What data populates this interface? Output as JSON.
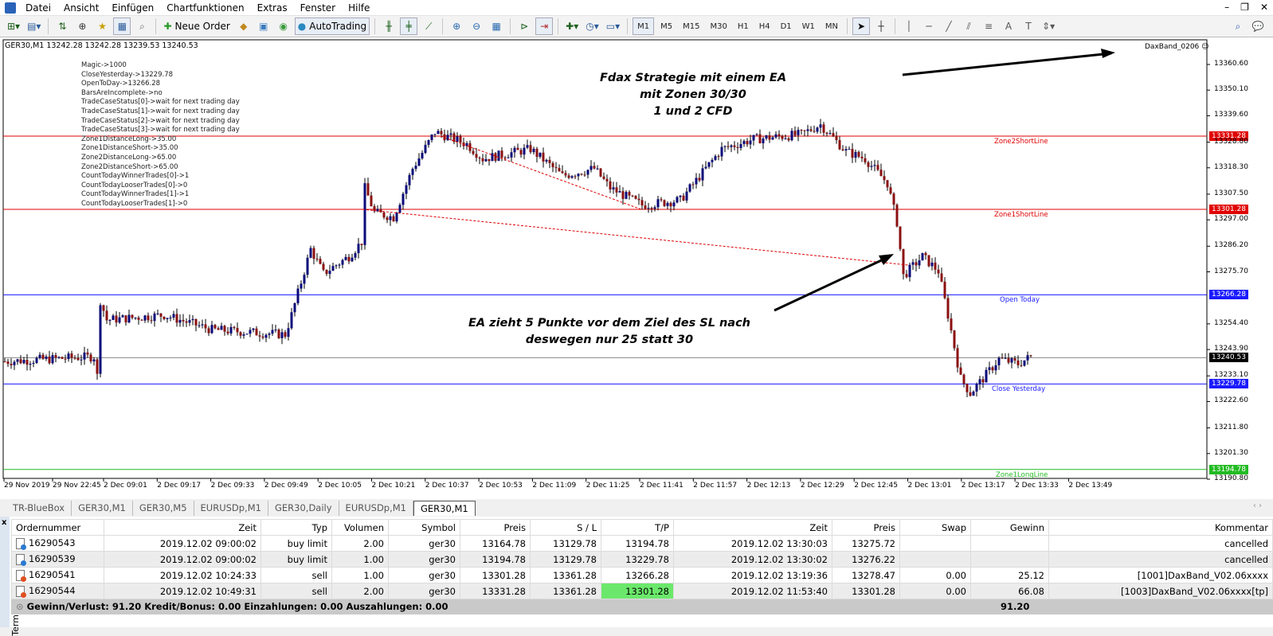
{
  "menu": {
    "items": [
      "Datei",
      "Ansicht",
      "Einfügen",
      "Chartfunktionen",
      "Extras",
      "Fenster",
      "Hilfe"
    ]
  },
  "toolbar": {
    "new_order": "Neue Order",
    "autotrading": "AutoTrading",
    "timeframes": [
      "M1",
      "M5",
      "M15",
      "M30",
      "H1",
      "H4",
      "D1",
      "W1",
      "MN"
    ],
    "active_timeframe": "M1"
  },
  "chart": {
    "symbol_line": "GER30,M1  13242.28 13242.28 13239.53 13240.53",
    "ea_name": "DaxBand_0206",
    "info_lines": [
      "Magic->1000",
      "CloseYesterday->13229.78",
      "OpenToDay->13266.28",
      "BarsAreIncomplete->no",
      "TradeCaseStatus[0]->wait for next trading day",
      "TradeCaseStatus[1]->wait for next trading day",
      "TradeCaseStatus[2]->wait for next trading day",
      "TradeCaseStatus[3]->wait for next trading day",
      "Zone1DistanceLong->35.00",
      "Zone1DistanceShort->35.00",
      "Zone2DistanceLong->65.00",
      "Zone2DistanceShort->65.00",
      "CountTodayWinnerTrades[0]->1",
      "CountTodayLooserTrades[0]->0",
      "CountTodayWinnerTrades[1]->1",
      "CountTodayLooserTrades[1]->0"
    ],
    "annotation1": [
      "Fdax Strategie mit einem EA",
      "mit Zonen 30/30",
      "1 und 2 CFD"
    ],
    "annotation2": [
      "EA zieht 5 Punkte vor dem Ziel des SL nach",
      "deswegen nur 25 statt 30"
    ],
    "price_ticks": [
      "13360.60",
      "13350.10",
      "13339.60",
      "13328.80",
      "13318.30",
      "13307.50",
      "13297.00",
      "13286.20",
      "13275.70",
      "13254.40",
      "13243.90",
      "13233.10",
      "13222.60",
      "13211.80",
      "13201.30",
      "13190.80"
    ],
    "price_range": [
      13190.8,
      13360.6
    ],
    "levels": [
      {
        "price": 13331.28,
        "label": "13331.28",
        "name": "Zone2ShortLine",
        "color": "#e00000"
      },
      {
        "price": 13301.28,
        "label": "13301.28",
        "name": "Zone1ShortLine",
        "color": "#e00000"
      },
      {
        "price": 13266.28,
        "label": "13266.28",
        "name": "Open Today",
        "color": "#1a1aff"
      },
      {
        "price": 13240.53,
        "label": "13240.53",
        "name": "",
        "color": "#000000"
      },
      {
        "price": 13229.78,
        "label": "13229.78",
        "name": "Close Yesterday",
        "color": "#1a1aff"
      },
      {
        "price": 13194.78,
        "label": "13194.78",
        "name": "Zone1LongLine",
        "color": "#22bb22"
      }
    ],
    "time_labels": [
      "29 Nov 2019",
      "29 Nov 22:45",
      "2 Dec 09:01",
      "2 Dec 09:17",
      "2 Dec 09:33",
      "2 Dec 09:49",
      "2 Dec 10:05",
      "2 Dec 10:21",
      "2 Dec 10:37",
      "2 Dec 10:53",
      "2 Dec 11:09",
      "2 Dec 11:25",
      "2 Dec 11:41",
      "2 Dec 11:57",
      "2 Dec 12:13",
      "2 Dec 12:29",
      "2 Dec 12:45",
      "2 Dec 13:01",
      "2 Dec 13:17",
      "2 Dec 13:33",
      "2 Dec 13:49"
    ],
    "price_path": [
      [
        0,
        13239
      ],
      [
        28,
        13241
      ],
      [
        29,
        13233
      ],
      [
        30,
        13264
      ],
      [
        32,
        13256
      ],
      [
        50,
        13258
      ],
      [
        65,
        13252
      ],
      [
        88,
        13250
      ],
      [
        90,
        13258
      ],
      [
        96,
        13285
      ],
      [
        100,
        13275
      ],
      [
        108,
        13282
      ],
      [
        112,
        13288
      ],
      [
        113,
        13310
      ],
      [
        116,
        13300
      ],
      [
        122,
        13298
      ],
      [
        128,
        13318
      ],
      [
        135,
        13333
      ],
      [
        145,
        13328
      ],
      [
        150,
        13322
      ],
      [
        165,
        13326
      ],
      [
        175,
        13315
      ],
      [
        185,
        13318
      ],
      [
        190,
        13310
      ],
      [
        200,
        13303
      ],
      [
        212,
        13305
      ],
      [
        220,
        13318
      ],
      [
        225,
        13326
      ],
      [
        235,
        13330
      ],
      [
        250,
        13332
      ],
      [
        256,
        13336
      ],
      [
        264,
        13325
      ],
      [
        270,
        13322
      ],
      [
        277,
        13312
      ],
      [
        280,
        13296
      ],
      [
        282,
        13274
      ],
      [
        285,
        13278
      ],
      [
        288,
        13282
      ],
      [
        293,
        13276
      ],
      [
        296,
        13258
      ],
      [
        300,
        13232
      ],
      [
        303,
        13226
      ],
      [
        307,
        13232
      ],
      [
        312,
        13240
      ],
      [
        318,
        13238
      ],
      [
        322,
        13241
      ]
    ]
  },
  "tabs": [
    "TR-BlueBox",
    "GER30,M1",
    "GER30,M5",
    "EURUSDp,M1",
    "GER30,Daily",
    "EURUSDp,M1",
    "GER30,M1"
  ],
  "terminal": {
    "side_label": "Terminal",
    "columns": [
      "Ordernummer",
      "Zeit",
      "Typ",
      "Volumen",
      "Symbol",
      "Preis",
      "S / L",
      "T/P",
      "Zeit",
      "Preis",
      "Swap",
      "Gewinn",
      "Kommentar"
    ],
    "rows": [
      {
        "kind": "buy",
        "cells": [
          "16290543",
          "2019.12.02 09:00:02",
          "buy limit",
          "2.00",
          "ger30",
          "13164.78",
          "13129.78",
          "13194.78",
          "2019.12.02 13:30:03",
          "13275.72",
          "",
          "",
          "cancelled"
        ]
      },
      {
        "kind": "buy",
        "cells": [
          "16290539",
          "2019.12.02 09:00:02",
          "buy limit",
          "1.00",
          "ger30",
          "13194.78",
          "13129.78",
          "13229.78",
          "2019.12.02 13:30:02",
          "13276.22",
          "",
          "",
          "cancelled"
        ]
      },
      {
        "kind": "sell",
        "cells": [
          "16290541",
          "2019.12.02 10:24:33",
          "sell",
          "1.00",
          "ger30",
          "13301.28",
          "13361.28",
          "13266.28",
          "2019.12.02 13:19:36",
          "13278.47",
          "0.00",
          "25.12",
          "[1001]DaxBand_V02.06xxxx"
        ]
      },
      {
        "kind": "sell",
        "cells": [
          "16290544",
          "2019.12.02 10:49:31",
          "sell",
          "2.00",
          "ger30",
          "13331.28",
          "13361.28",
          "13301.28",
          "2019.12.02 11:53:40",
          "13301.28",
          "0.00",
          "66.08",
          "[1003]DaxBand_V02.06xxxx[tp]"
        ]
      }
    ],
    "footer": "Gewinn/Verlust: 91.20  Kredit/Bonus: 0.00  Einzahlungen: 0.00  Auszahlungen: 0.00",
    "total": "91.20"
  }
}
